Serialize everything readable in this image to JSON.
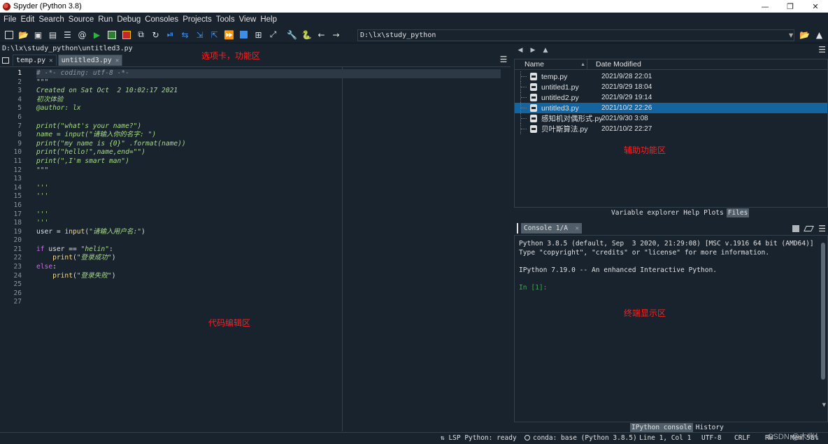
{
  "window": {
    "title": "Spyder (Python 3.8)",
    "controls": [
      "—",
      "❐",
      "✕"
    ]
  },
  "menubar": [
    "File",
    "Edit",
    "Search",
    "Source",
    "Run",
    "Debug",
    "Consoles",
    "Projects",
    "Tools",
    "View",
    "Help"
  ],
  "toolbar": {
    "path": "D:\\lx\\study_python"
  },
  "editor": {
    "file_path": "D:\\lx\\study_python\\untitled3.py",
    "tabs": [
      {
        "label": "temp.py",
        "close": "✕"
      },
      {
        "label": "untitled3.py",
        "close": "✕"
      }
    ],
    "menu_icon": "☰",
    "line_numbers": [
      "1",
      "2",
      "3",
      "4",
      "5",
      "6",
      "7",
      "8",
      "9",
      "10",
      "11",
      "12",
      "13",
      "14",
      "15",
      "16",
      "17",
      "18",
      "19",
      "20",
      "21",
      "22",
      "23",
      "24",
      "25",
      "26",
      "27"
    ],
    "code": [
      "# -*- coding: utf-8 -*-",
      "\"\"\"",
      "Created on Sat Oct  2 10:02:17 2021",
      "初次体验",
      "@author: lx",
      "",
      "print(\"what's your name?\")",
      "name = input(\"请输入你的名字: \")",
      "print(\"my name is {0}\" .format(name))",
      "print(\"hello!\",name,end=\"\")",
      "print(\",I'm smart man\")",
      "\"\"\"",
      "",
      "'''",
      "'''",
      "",
      "'''",
      "'''",
      "user = input(\"请输入用户名:\")",
      "",
      "if user == \"helin\":",
      "    print(\"登录成功\")",
      "else:",
      "    print(\"登录失败\")",
      "",
      "",
      ""
    ]
  },
  "annotations": {
    "tabs_area": "选项卡，功能区",
    "editor_area": "代码编辑区",
    "files_area": "辅助功能区",
    "console_area": "终端显示区"
  },
  "files": {
    "menu_icon": "☰",
    "columns": {
      "name": "Name",
      "date": "Date Modified"
    },
    "rows": [
      {
        "name": "temp.py",
        "date": "2021/9/28 22:01",
        "selected": false
      },
      {
        "name": "untitled1.py",
        "date": "2021/9/29 18:04",
        "selected": false
      },
      {
        "name": "untitled2.py",
        "date": "2021/9/29 19:14",
        "selected": false
      },
      {
        "name": "untitled3.py",
        "date": "2021/10/2 22:26",
        "selected": true
      },
      {
        "name": "感知机对偶形式.py",
        "date": "2021/9/30 3:08",
        "selected": false
      },
      {
        "name": "贝叶斯算法.py",
        "date": "2021/10/2 22:27",
        "selected": false
      }
    ],
    "pane_tabs": [
      "Variable explorer",
      "Help",
      "Plots",
      "Files"
    ],
    "active_tab": "Files"
  },
  "console": {
    "tab_label": "Console 1/A",
    "close": "✕",
    "menu_icon": "☰",
    "lines": [
      "Python 3.8.5 (default, Sep  3 2020, 21:29:08) [MSC v.1916 64 bit (AMD64)]",
      "Type \"copyright\", \"credits\" or \"license\" for more information.",
      "",
      "IPython 7.19.0 -- An enhanced Interactive Python.",
      ""
    ],
    "prompt": "In [1]:",
    "pane_tabs": [
      "IPython console",
      "History"
    ],
    "active_tab": "IPython console"
  },
  "statusbar": {
    "lsp": "LSP Python: ready",
    "conda": "conda: base (Python 3.8.5)",
    "position": "Line 1, Col 1",
    "encoding": "UTF-8",
    "eol": "CRLF",
    "rw": "RW",
    "mem": "Mem 58%"
  },
  "watermark": "CSDN @木兆！",
  "colors": {
    "background": "#19232d",
    "annotation": "#ff2020",
    "selection": "#1464a0",
    "string": "#a7dc86",
    "keyword": "#c670e0"
  }
}
